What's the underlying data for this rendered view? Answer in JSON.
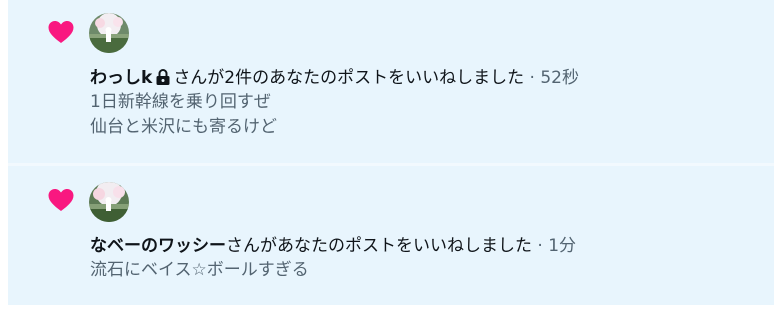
{
  "colors": {
    "like_heart": "#f91880",
    "notification_bg": "#e8f5fd",
    "primary_text": "#0f1419",
    "secondary_text": "#536471"
  },
  "notifications": [
    {
      "icon": "heart-icon",
      "user_name": "わっしk",
      "protected_icon": "lock-icon",
      "action_text": "さんが2件のあなたのポストをいいねしました",
      "separator": " · ",
      "time": "52秒",
      "preview_lines": [
        "1日新幹線を乗り回すぜ",
        "仙台と米沢にも寄るけど"
      ]
    },
    {
      "icon": "heart-icon",
      "user_name": "なベーのワッシー",
      "action_text": "さんがあなたのポストをいいねしました",
      "separator": " · ",
      "time": "1分",
      "preview_lines": [
        "流石にベイス☆ボールすぎる"
      ]
    }
  ]
}
